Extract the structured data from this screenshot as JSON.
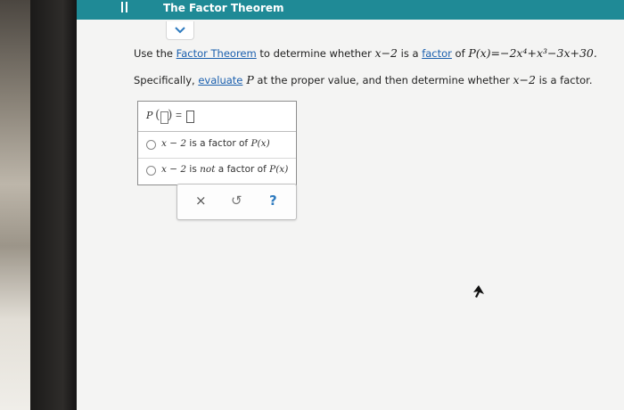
{
  "header": {
    "title": "The Factor Theorem",
    "menu_icon": "menu-icon"
  },
  "question": {
    "line1_prefix": "Use the ",
    "line1_link1": "Factor Theorem",
    "line1_mid": " to determine whether ",
    "line1_divisor": "x−2",
    "line1_mid2": " is a ",
    "line1_link2": "factor",
    "line1_mid3": " of ",
    "line1_poly": "P(x)=−2x⁴+x³−3x+30.",
    "line2_prefix": "Specifically, ",
    "line2_link": "evaluate",
    "line2_p": " P",
    "line2_mid": " at the proper value, and then determine whether ",
    "line2_divisor": "x−2",
    "line2_suffix": " is a factor."
  },
  "answer": {
    "p_label": "P",
    "equals": "=",
    "option1_a": "x − 2",
    "option1_b": " is a factor of ",
    "option1_c": "P(x)",
    "option2_a": "x − 2",
    "option2_b": " is ",
    "option2_not": "not",
    "option2_c": " a factor of ",
    "option2_d": "P(x)"
  },
  "controls": {
    "clear": "×",
    "undo": "↺",
    "help": "?"
  },
  "colors": {
    "header_bg": "#1f8a96",
    "link": "#1a5fae",
    "help": "#2f7bbf"
  }
}
